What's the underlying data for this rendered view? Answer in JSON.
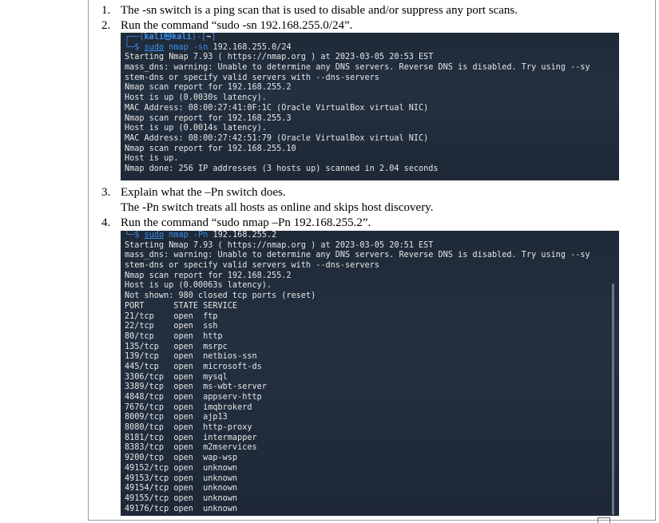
{
  "items": [
    {
      "num": "1.",
      "text": "The -sn switch is a ping scan that is used to disable and/or suppress any port scans."
    },
    {
      "num": "2.",
      "text": "Run the command “sudo -sn 192.168.255.0/24”."
    },
    {
      "num": "3.",
      "text": "Explain what the –Pn switch does."
    },
    {
      "answer": "The -Pn switch treats all hosts as online and skips host discovery."
    },
    {
      "num": "4.",
      "text": "Run the command “sudo nmap –Pn 192.168.255.2”."
    }
  ],
  "terminal1": {
    "prompt_top_left": "┌──(",
    "prompt_user": "kali㉿kali",
    "prompt_mid": ")-[",
    "prompt_path": "~",
    "prompt_end": "]",
    "cmd_prefix": "└─$ ",
    "cmd_sudo": "sudo",
    "cmd_bin": "nmap",
    "cmd_flag": "-sn",
    "cmd_arg": "192.168.255.0/24",
    "lines": [
      "Starting Nmap 7.93 ( https://nmap.org ) at 2023-03-05 20:53 EST",
      "mass_dns: warning: Unable to determine any DNS servers. Reverse DNS is disabled. Try using --sy",
      "stem-dns or specify valid servers with --dns-servers",
      "Nmap scan report for 192.168.255.2",
      "Host is up (0.0030s latency).",
      "MAC Address: 08:00:27:41:0F:1C (Oracle VirtualBox virtual NIC)",
      "Nmap scan report for 192.168.255.3",
      "Host is up (0.0014s latency).",
      "MAC Address: 08:00:27:42:51:79 (Oracle VirtualBox virtual NIC)",
      "Nmap scan report for 192.168.255.10",
      "Host is up.",
      "Nmap done: 256 IP addresses (3 hosts up) scanned in 2.04 seconds"
    ]
  },
  "terminal2": {
    "cmd_prefix": "└─$ ",
    "cmd_sudo": "sudo",
    "cmd_bin": "nmap",
    "cmd_flag": "-Pn",
    "cmd_arg": "192.168.255.2",
    "lines": [
      "Starting Nmap 7.93 ( https://nmap.org ) at 2023-03-05 20:51 EST",
      "mass_dns: warning: Unable to determine any DNS servers. Reverse DNS is disabled. Try using --sy",
      "stem-dns or specify valid servers with --dns-servers",
      "Nmap scan report for 192.168.255.2",
      "Host is up (0.00063s latency).",
      "Not shown: 980 closed tcp ports (reset)",
      "PORT      STATE SERVICE",
      "21/tcp    open  ftp",
      "22/tcp    open  ssh",
      "80/tcp    open  http",
      "135/tcp   open  msrpc",
      "139/tcp   open  netbios-ssn",
      "445/tcp   open  microsoft-ds",
      "3306/tcp  open  mysql",
      "3389/tcp  open  ms-wbt-server",
      "4848/tcp  open  appserv-http",
      "7676/tcp  open  imqbrokerd",
      "8009/tcp  open  ajp13",
      "8080/tcp  open  http-proxy",
      "8181/tcp  open  intermapper",
      "8383/tcp  open  m2mservices",
      "9200/tcp  open  wap-wsp",
      "49152/tcp open  unknown",
      "49153/tcp open  unknown",
      "49154/tcp open  unknown",
      "49155/tcp open  unknown",
      "49176/tcp open  unknown"
    ]
  }
}
